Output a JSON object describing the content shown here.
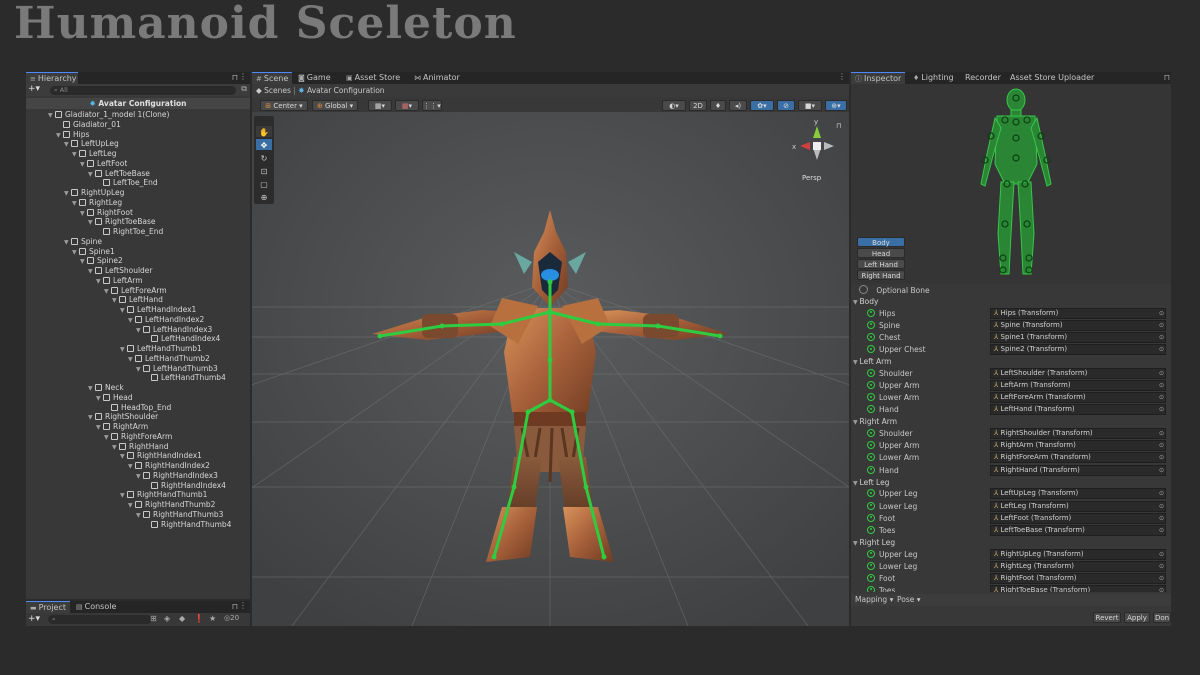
{
  "title": "Humanoid Sceleton",
  "hierarchy": {
    "tab": "Hierarchy",
    "search_placeholder": "All",
    "root": "Avatar Configuration",
    "items": [
      {
        "label": "Gladiator_1_model 1(Clone)",
        "depth": 1,
        "tri": true
      },
      {
        "label": "Gladiator_01",
        "depth": 2,
        "tri": false
      },
      {
        "label": "Hips",
        "depth": 2,
        "tri": true
      },
      {
        "label": "LeftUpLeg",
        "depth": 3,
        "tri": true
      },
      {
        "label": "LeftLeg",
        "depth": 4,
        "tri": true
      },
      {
        "label": "LeftFoot",
        "depth": 5,
        "tri": true
      },
      {
        "label": "LeftToeBase",
        "depth": 6,
        "tri": true
      },
      {
        "label": "LeftToe_End",
        "depth": 7,
        "tri": false
      },
      {
        "label": "RightUpLeg",
        "depth": 3,
        "tri": true
      },
      {
        "label": "RightLeg",
        "depth": 4,
        "tri": true
      },
      {
        "label": "RightFoot",
        "depth": 5,
        "tri": true
      },
      {
        "label": "RightToeBase",
        "depth": 6,
        "tri": true
      },
      {
        "label": "RightToe_End",
        "depth": 7,
        "tri": false
      },
      {
        "label": "Spine",
        "depth": 3,
        "tri": true
      },
      {
        "label": "Spine1",
        "depth": 4,
        "tri": true
      },
      {
        "label": "Spine2",
        "depth": 5,
        "tri": true
      },
      {
        "label": "LeftShoulder",
        "depth": 6,
        "tri": true
      },
      {
        "label": "LeftArm",
        "depth": 7,
        "tri": true
      },
      {
        "label": "LeftForeArm",
        "depth": 8,
        "tri": true
      },
      {
        "label": "LeftHand",
        "depth": 9,
        "tri": true
      },
      {
        "label": "LeftHandIndex1",
        "depth": 10,
        "tri": true
      },
      {
        "label": "LeftHandIndex2",
        "depth": 11,
        "tri": true
      },
      {
        "label": "LeftHandIndex3",
        "depth": 12,
        "tri": true
      },
      {
        "label": "LeftHandIndex4",
        "depth": 13,
        "tri": false
      },
      {
        "label": "LeftHandThumb1",
        "depth": 10,
        "tri": true
      },
      {
        "label": "LeftHandThumb2",
        "depth": 11,
        "tri": true
      },
      {
        "label": "LeftHandThumb3",
        "depth": 12,
        "tri": true
      },
      {
        "label": "LeftHandThumb4",
        "depth": 13,
        "tri": false
      },
      {
        "label": "Neck",
        "depth": 6,
        "tri": true
      },
      {
        "label": "Head",
        "depth": 7,
        "tri": true
      },
      {
        "label": "HeadTop_End",
        "depth": 8,
        "tri": false
      },
      {
        "label": "RightShoulder",
        "depth": 6,
        "tri": true
      },
      {
        "label": "RightArm",
        "depth": 7,
        "tri": true
      },
      {
        "label": "RightForeArm",
        "depth": 8,
        "tri": true
      },
      {
        "label": "RightHand",
        "depth": 9,
        "tri": true
      },
      {
        "label": "RightHandIndex1",
        "depth": 10,
        "tri": true
      },
      {
        "label": "RightHandIndex2",
        "depth": 11,
        "tri": true
      },
      {
        "label": "RightHandIndex3",
        "depth": 12,
        "tri": true
      },
      {
        "label": "RightHandIndex4",
        "depth": 13,
        "tri": false
      },
      {
        "label": "RightHandThumb1",
        "depth": 10,
        "tri": true
      },
      {
        "label": "RightHandThumb2",
        "depth": 11,
        "tri": true
      },
      {
        "label": "RightHandThumb3",
        "depth": 12,
        "tri": true
      },
      {
        "label": "RightHandThumb4",
        "depth": 13,
        "tri": false
      }
    ]
  },
  "bottom_panel": {
    "tabs": [
      "Project",
      "Console"
    ],
    "count": "20"
  },
  "center": {
    "tabs": [
      "Scene",
      "Game",
      "Asset Store",
      "Animator"
    ],
    "breadcrumb_root": "Scenes",
    "breadcrumb_current": "Avatar Configuration",
    "toolbar": {
      "pivot": "Center",
      "space": "Global",
      "mode2d": "2D"
    },
    "persp": "Persp"
  },
  "inspector": {
    "tabs": [
      "Inspector",
      "Lighting",
      "Recorder",
      "Asset Store Uploader"
    ],
    "part_buttons": [
      "Body",
      "Head",
      "Left Hand",
      "Right Hand"
    ],
    "optional_bone": "Optional Bone",
    "groups": [
      {
        "name": "Body",
        "bones": [
          {
            "label": "Hips",
            "value": "Hips (Transform)"
          },
          {
            "label": "Spine",
            "value": "Spine (Transform)"
          },
          {
            "label": "Chest",
            "value": "Spine1 (Transform)"
          },
          {
            "label": "Upper Chest",
            "value": "Spine2 (Transform)"
          }
        ]
      },
      {
        "name": "Left Arm",
        "bones": [
          {
            "label": "Shoulder",
            "value": "LeftShoulder (Transform)"
          },
          {
            "label": "Upper Arm",
            "value": "LeftArm (Transform)"
          },
          {
            "label": "Lower Arm",
            "value": "LeftForeArm (Transform)"
          },
          {
            "label": "Hand",
            "value": "LeftHand (Transform)"
          }
        ]
      },
      {
        "name": "Right Arm",
        "bones": [
          {
            "label": "Shoulder",
            "value": "RightShoulder (Transform)"
          },
          {
            "label": "Upper Arm",
            "value": "RightArm (Transform)"
          },
          {
            "label": "Lower Arm",
            "value": "RightForeArm (Transform)"
          },
          {
            "label": "Hand",
            "value": "RightHand (Transform)"
          }
        ]
      },
      {
        "name": "Left Leg",
        "bones": [
          {
            "label": "Upper Leg",
            "value": "LeftUpLeg (Transform)"
          },
          {
            "label": "Lower Leg",
            "value": "LeftLeg (Transform)"
          },
          {
            "label": "Foot",
            "value": "LeftFoot (Transform)"
          },
          {
            "label": "Toes",
            "value": "LeftToeBase (Transform)"
          }
        ]
      },
      {
        "name": "Right Leg",
        "bones": [
          {
            "label": "Upper Leg",
            "value": "RightUpLeg (Transform)"
          },
          {
            "label": "Lower Leg",
            "value": "RightLeg (Transform)"
          },
          {
            "label": "Foot",
            "value": "RightFoot (Transform)"
          },
          {
            "label": "Toes",
            "value": "RightToeBase (Transform)"
          }
        ]
      }
    ],
    "mapping": "Mapping",
    "pose": "Pose",
    "revert": "Revert",
    "apply": "Apply",
    "done": "Don"
  },
  "colors": {
    "bone_green": "#2ecc40",
    "accent_blue": "#3a6fa6",
    "bg": "#2b2b2b"
  }
}
